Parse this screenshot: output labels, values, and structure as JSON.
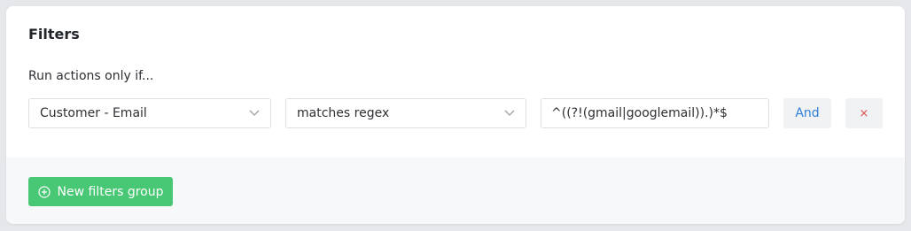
{
  "filters": {
    "title": "Filters",
    "subtitle": "Run actions only if...",
    "condition": {
      "field_value": "Customer - Email",
      "operator_value": "matches regex",
      "pattern_value": "^((?!(gmail|googlemail)).)*$",
      "and_label": "And",
      "remove_label": "×"
    },
    "new_group_label": "New filters group"
  },
  "colors": {
    "accent_blue": "#2f7ed8",
    "success_green": "#48c774",
    "danger_red": "#d9534f"
  },
  "icons": [
    "chevron-down-icon",
    "plus-circle-icon"
  ]
}
